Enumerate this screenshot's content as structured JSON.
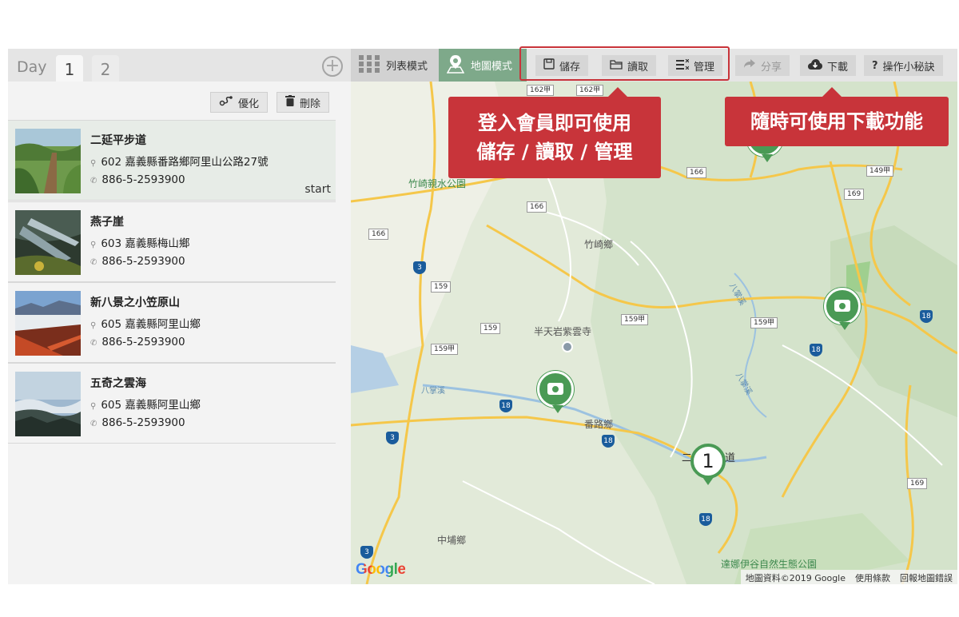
{
  "day_bar": {
    "label": "Day",
    "tabs": [
      "1",
      "2"
    ],
    "add": "+"
  },
  "left_toolbar": {
    "optimize": "優化",
    "delete": "刪除"
  },
  "places": [
    {
      "name": "二延平步道",
      "address": "602 嘉義縣番路鄉阿里山公路27號",
      "phone": "886-5-2593900",
      "tag": "start"
    },
    {
      "name": "燕子崖",
      "address": "603 嘉義縣梅山鄉",
      "phone": "886-5-2593900",
      "tag": ""
    },
    {
      "name": "新八景之小笠原山",
      "address": "605 嘉義縣阿里山鄉",
      "phone": "886-5-2593900",
      "tag": ""
    },
    {
      "name": "五奇之雲海",
      "address": "605 嘉義縣阿里山鄉",
      "phone": "886-5-2593900",
      "tag": ""
    }
  ],
  "modes": {
    "list": "列表模式",
    "map": "地圖模式"
  },
  "toolbar": {
    "save": "儲存",
    "load": "讀取",
    "manage": "管理",
    "share": "分享",
    "download": "下載",
    "tips": "操作小秘訣"
  },
  "callouts": {
    "member_line1": "登入會員即可使用",
    "member_line2": "儲存 / 讀取 / 管理",
    "download": "隨時可使用下載功能"
  },
  "map": {
    "labels": [
      "竹崎親水公園",
      "竹崎鄉",
      "半天岩紫雲寺",
      "番路鄉",
      "中埔鄉",
      "達娜伊谷自然生態公園",
      "八掌溪",
      "八掌溪",
      "八掌溪",
      "二",
      "道"
    ],
    "roads": [
      "162甲",
      "162甲",
      "166",
      "166",
      "166",
      "159",
      "159",
      "159甲",
      "159甲",
      "159甲",
      "149甲",
      "169",
      "169",
      "18",
      "18",
      "18",
      "18",
      "3",
      "3",
      "3"
    ],
    "pin_number": "1",
    "google": "Google",
    "footer_attribution": "地圖資料©2019 Google",
    "footer_terms": "使用條款",
    "footer_report": "回報地圖錯誤"
  },
  "colors": {
    "accent_red": "#c8343a",
    "active_green": "#4a9a55",
    "map_mode_bg": "#7ea98a"
  }
}
